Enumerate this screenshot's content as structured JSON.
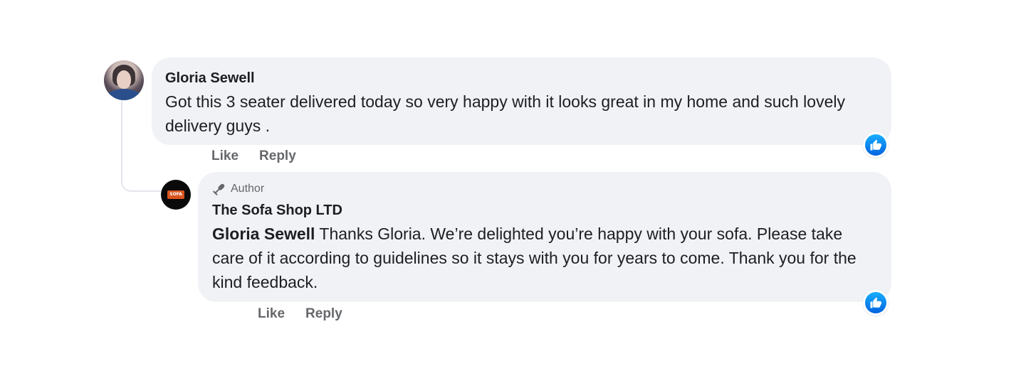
{
  "comment": {
    "author": "Gloria Sewell",
    "text": "Got this 3 seater delivered today so very happy with it looks great in my home and such lovely delivery guys .",
    "actions": {
      "like": "Like",
      "reply": "Reply"
    },
    "reaction_icon": "like-icon"
  },
  "reply": {
    "badge": "Author",
    "author": "The Sofa Shop LTD",
    "mention": "Gloria Sewell",
    "text": " Thanks Gloria. We’re delighted you’re happy with your sofa. Please take care of it according to guidelines so it stays with you for years to come. Thank you for the kind feedback.",
    "actions": {
      "like": "Like",
      "reply": "Reply"
    },
    "reaction_icon": "like-icon",
    "avatar_logo": "SOFA"
  },
  "colors": {
    "bubble": "#f0f2f5",
    "secondary_text": "#65676b",
    "like_blue": "#0866ff"
  }
}
